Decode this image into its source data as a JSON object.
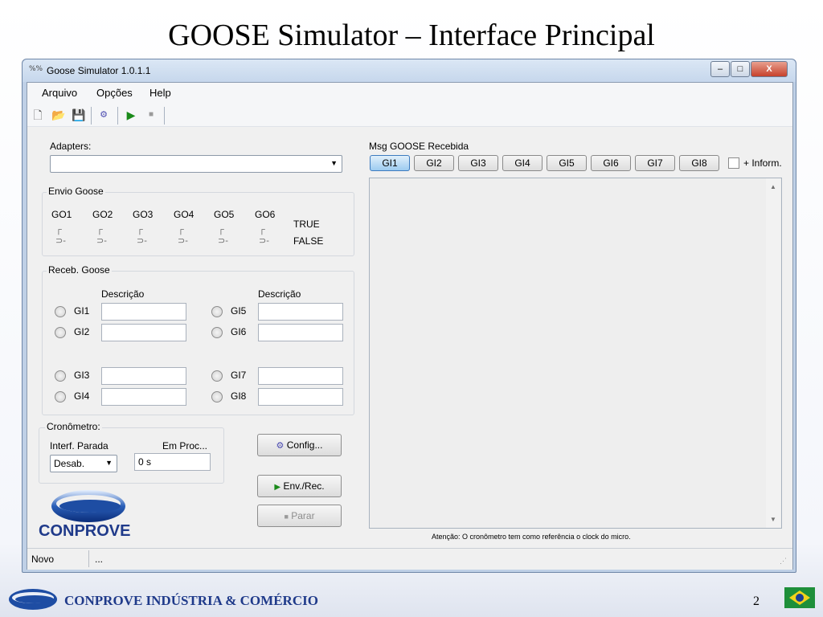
{
  "slide": {
    "title": "GOOSE Simulator – Interface Principal",
    "footer_company": "CONPROVE INDÚSTRIA & COMÉRCIO",
    "page_number": "2"
  },
  "window": {
    "icon_glyph": "%%",
    "title": "Goose Simulator 1.0.1.1",
    "minimize": "–",
    "maximize": "□",
    "close": "X"
  },
  "menu": [
    "Arquivo",
    "Opções",
    "Help"
  ],
  "toolbar": {
    "icons": [
      "new-file-icon",
      "open-folder-icon",
      "save-icon",
      "network-icon",
      "play-icon",
      "stop-icon"
    ]
  },
  "adapters": {
    "label": "Adapters:",
    "value": ""
  },
  "envio": {
    "title": "Envio Goose",
    "outputs": [
      "GO1",
      "GO2",
      "GO3",
      "GO4",
      "GO5",
      "GO6"
    ],
    "true_label": "TRUE",
    "false_label": "FALSE"
  },
  "receb": {
    "title": "Receb. Goose",
    "descr_header": "Descrição",
    "inputs_left": [
      "GI1",
      "GI2",
      "GI3",
      "GI4"
    ],
    "inputs_right": [
      "GI5",
      "GI6",
      "GI7",
      "GI8"
    ]
  },
  "cronometro": {
    "title": "Cronômetro:",
    "interf_label": "Interf. Parada",
    "interf_value": "Desab.",
    "proc_label": "Em Proc...",
    "proc_value": "0 s"
  },
  "buttons": {
    "config": "Config...",
    "env_rec": "Env./Rec.",
    "parar": "Parar"
  },
  "logo": {
    "text": "CONPROVE"
  },
  "msg": {
    "label": "Msg GOOSE Recebida",
    "tabs": [
      "GI1",
      "GI2",
      "GI3",
      "GI4",
      "GI5",
      "GI6",
      "GI7",
      "GI8"
    ],
    "active_tab": "GI1",
    "more_info": "+ Inform.",
    "note": "Atenção: O cronômetro tem como referência o clock do micro."
  },
  "status": {
    "left": "Novo",
    "right": "..."
  },
  "colors": {
    "window_frame": "#bfd0e6",
    "active_tab": "#9ccbf0",
    "logo_blue": "#1f3a8a"
  }
}
